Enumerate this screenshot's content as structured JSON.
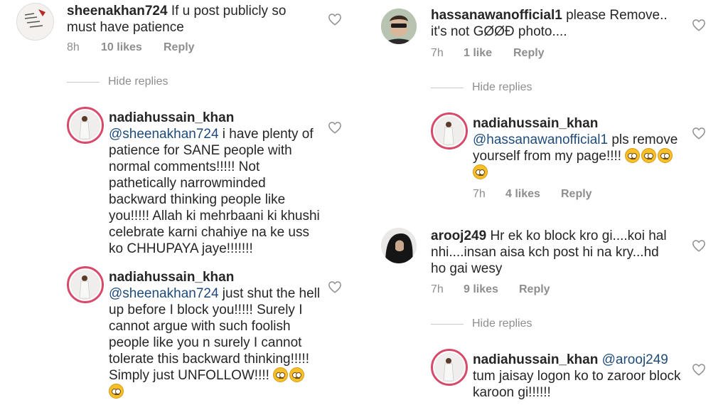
{
  "left": {
    "c1": {
      "user": "sheenakhan724",
      "text": "If u post publicly so must have patience",
      "time": "8h",
      "likes": "10 likes",
      "reply": "Reply"
    },
    "hide_replies": "Hide replies",
    "c2": {
      "user": "nadiahussain_khan",
      "mention": "@sheenakhan724",
      "text": " i have plenty of patience for SANE people with normal comments!!!!! Not pathetically narrowminded backward thinking people like you!!!!! Allah ki mehrbaani ki khushi celebrate karni chahiye na ke uss ko CHHUPAYA jaye!!!!!!!"
    },
    "c3": {
      "user": "nadiahussain_khan",
      "mention": "@sheenakhan724",
      "text": " just shut the hell up before I block you!!!!! Surely I cannot argue with such foolish people like you n surely I cannot tolerate this backward thinking!!!!! Simply just UNFOLLOW!!!! "
    }
  },
  "right": {
    "c1": {
      "user": "hassanawanofficial1",
      "text": "please Remove.. it's  not GØØÐ  photo....",
      "time": "7h",
      "likes": "1 like",
      "reply": "Reply"
    },
    "hide_replies_1": "Hide replies",
    "c2": {
      "user": "nadiahussain_khan",
      "mention": "@hassanawanofficial1",
      "text": " pls remove yourself from my page!!!! ",
      "time": "7h",
      "likes": "4 likes",
      "reply": "Reply"
    },
    "c3": {
      "user": "arooj249",
      "text": "Hr ek ko block kro gi....koi hal nhi....insan aisa kch post hi na kry...hd ho gai wesy",
      "time": "7h",
      "likes": "9 likes",
      "reply": "Reply"
    },
    "hide_replies_2": "Hide replies",
    "c4": {
      "user": "nadiahussain_khan",
      "mention": "@arooj249",
      "text": " tum jaisay logon ko to zaroor block karoon gi!!!!!!"
    }
  },
  "icons": {
    "heart": "heart-outline-icon",
    "emoji": "face-with-rolling-eyes-emoji"
  },
  "colors": {
    "story_ring": "#d84a6a",
    "mention": "#1f4b7a",
    "meta": "#8e8e8e"
  }
}
